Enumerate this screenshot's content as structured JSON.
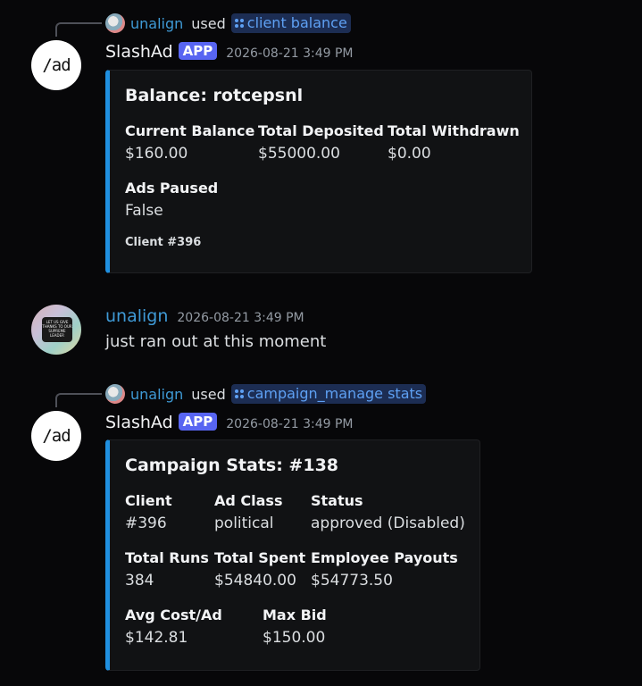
{
  "messages": [
    {
      "command": {
        "user": "unalign",
        "used": "used",
        "name": "client balance"
      },
      "author": "SlashAd",
      "badge": "APP",
      "avatar_text": "/ad",
      "timestamp": "2026-08-21 3:49 PM",
      "embed": {
        "title": "Balance: rotcepsnl",
        "fields": [
          {
            "name": "Current Balance",
            "value": "$160.00"
          },
          {
            "name": "Total Deposited",
            "value": "$55000.00"
          },
          {
            "name": "Total Withdrawn",
            "value": "$0.00"
          },
          {
            "name": "Ads Paused",
            "value": "False"
          }
        ],
        "footer": "Client #396",
        "accent": "#1f8fe0"
      }
    },
    {
      "author": "unalign",
      "timestamp": "2026-08-21 3:49 PM",
      "text": "just ran out at this moment",
      "avatar_sticker": "LET US GIVE THANKS TO OUR SUPREME LEADER"
    },
    {
      "command": {
        "user": "unalign",
        "used": "used",
        "name": "campaign_manage stats"
      },
      "author": "SlashAd",
      "badge": "APP",
      "avatar_text": "/ad",
      "timestamp": "2026-08-21 3:49 PM",
      "embed": {
        "title": "Campaign Stats: #138",
        "fields": [
          {
            "name": "Client",
            "value": "#396"
          },
          {
            "name": "Ad Class",
            "value": "political"
          },
          {
            "name": "Status",
            "value": "approved (Disabled)"
          },
          {
            "name": "Total Runs",
            "value": "384"
          },
          {
            "name": "Total Spent",
            "value": "$54840.00"
          },
          {
            "name": "Employee Payouts",
            "value": "$54773.50"
          },
          {
            "name": "Avg Cost/Ad",
            "value": "$142.81"
          },
          {
            "name": "Max Bid",
            "value": "$150.00"
          }
        ],
        "accent": "#1f8fe0"
      }
    }
  ],
  "colors": {
    "background": "#070709",
    "embed_background": "#111214",
    "username": "#3f9ad6",
    "app_badge": "#5865f2",
    "command_pill": "#1c2d53"
  }
}
